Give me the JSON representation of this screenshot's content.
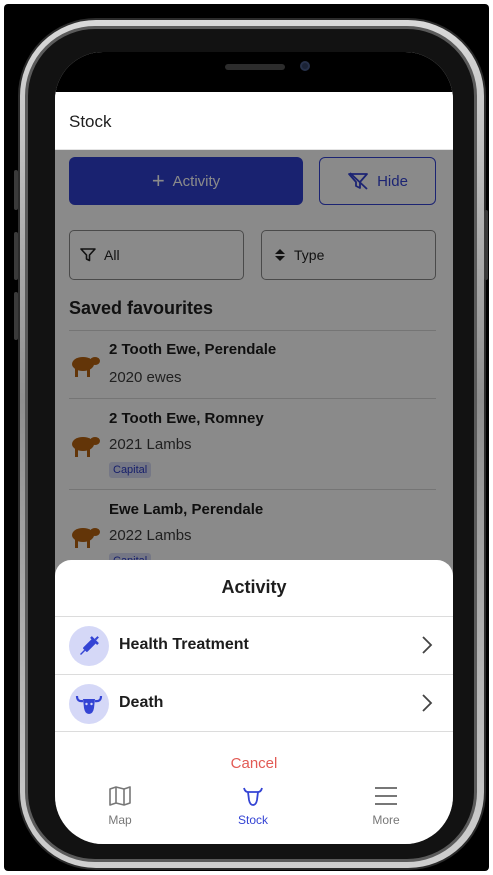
{
  "app": {
    "title": "Stock"
  },
  "actions": {
    "activity_label": "Activity",
    "hide_label": "Hide"
  },
  "filters": {
    "all_label": "All",
    "type_label": "Type"
  },
  "favourites": {
    "title": "Saved favourites",
    "items": [
      {
        "name": "2 Tooth Ewe, Perendale",
        "mob": "2020 ewes",
        "tag": ""
      },
      {
        "name": "2 Tooth Ewe, Romney",
        "mob": "2021 Lambs",
        "tag": "Capital"
      },
      {
        "name": "Ewe Lamb, Perendale",
        "mob": "2022 Lambs",
        "tag": "Capital"
      }
    ]
  },
  "sheet": {
    "title": "Activity",
    "options": [
      {
        "label": "Health Treatment",
        "icon": "syringe-icon"
      },
      {
        "label": "Death",
        "icon": "cow-head-icon"
      }
    ],
    "cancel_label": "Cancel"
  },
  "tabbar": {
    "tabs": [
      {
        "label": "Map",
        "icon": "map-icon",
        "active": false
      },
      {
        "label": "Stock",
        "icon": "cow-outline-icon",
        "active": true
      },
      {
        "label": "More",
        "icon": "menu-icon",
        "active": false
      }
    ]
  },
  "colors": {
    "primary": "#2f3fd0",
    "sheep": "#b8620f",
    "tag_bg": "#d9dcf6",
    "cancel": "#e25a54"
  }
}
